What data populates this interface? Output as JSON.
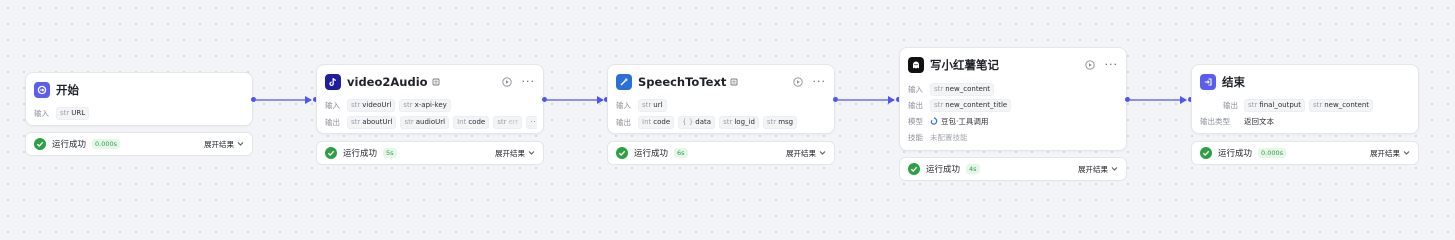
{
  "nodes": {
    "start": {
      "title": "开始",
      "input_label": "输入",
      "inputs": [
        {
          "type": "str",
          "name": "URL"
        }
      ],
      "status": {
        "text": "运行成功",
        "time": "0.000s",
        "expand": "展开结果"
      }
    },
    "video2audio": {
      "title": "video2Audio",
      "input_label": "输入",
      "inputs": [
        {
          "type": "str",
          "name": "videoUrl"
        },
        {
          "type": "str",
          "name": "x-api-key"
        }
      ],
      "output_label": "输出",
      "outputs": [
        {
          "type": "str",
          "name": "aboutUrl"
        },
        {
          "type": "str",
          "name": "audioUrl"
        },
        {
          "type": "Int",
          "name": "code"
        },
        {
          "type": "str",
          "name": "err"
        }
      ],
      "more": "···",
      "status": {
        "text": "运行成功",
        "time": "5s",
        "expand": "展开结果"
      }
    },
    "speech": {
      "title": "SpeechToText",
      "input_label": "输入",
      "inputs": [
        {
          "type": "str",
          "name": "url"
        }
      ],
      "output_label": "输出",
      "outputs": [
        {
          "type": "Int",
          "name": "code"
        },
        {
          "type": "{ }",
          "name": "data"
        },
        {
          "type": "str",
          "name": "log_id"
        },
        {
          "type": "str",
          "name": "msg"
        }
      ],
      "status": {
        "text": "运行成功",
        "time": "6s",
        "expand": "展开结果"
      }
    },
    "xhs": {
      "title": "写小红薯笔记",
      "input_label": "输入",
      "inputs": [
        {
          "type": "str",
          "name": "new_content"
        }
      ],
      "output_label": "输出",
      "outputs": [
        {
          "type": "str",
          "name": "new_content_title"
        }
      ],
      "model_label": "模型",
      "model_value": "豆包·工具调用",
      "skill_label": "技能",
      "skill_value": "未配置技能",
      "status": {
        "text": "运行成功",
        "time": "4s",
        "expand": "展开结果"
      }
    },
    "end": {
      "title": "结束",
      "output_label": "输出",
      "outputs": [
        {
          "type": "str",
          "name": "final_output"
        },
        {
          "type": "str",
          "name": "new_content"
        }
      ],
      "output_type_label": "输出类型",
      "output_type_value": "返回文本",
      "status": {
        "text": "运行成功",
        "time": "0.000s",
        "expand": "展开结果"
      }
    }
  },
  "colors": {
    "accent": "#4f55f1",
    "success": "#2ea043",
    "start_icon": "#5b5cf0",
    "end_icon": "#5b5cf0",
    "tiktok_icon": "#1f1f9e",
    "speech_icon": "#2c6fd6",
    "xhs_icon": "#111111"
  },
  "icons": {
    "start": "start-login-icon",
    "video2audio": "tiktok-icon",
    "speech": "speech-plugin-icon",
    "xhs": "llm-ghost-icon",
    "end": "end-exit-icon",
    "status": "check-circle-icon",
    "run": "play-circle-icon",
    "doc": "document-icon",
    "expand": "chevron-down-icon",
    "model": "doubao-model-icon"
  }
}
